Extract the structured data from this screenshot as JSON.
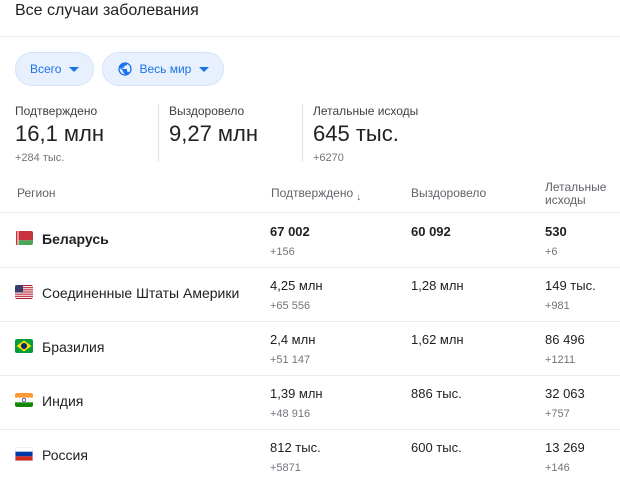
{
  "header": {
    "title": "Все случаи заболевания"
  },
  "filters": {
    "scope": {
      "label": "Всего",
      "icon": "caret-down-icon"
    },
    "region": {
      "label": "Весь мир",
      "icon": "globe-icon"
    }
  },
  "summary": [
    {
      "label": "Подтверждено",
      "value": "16,1 млн",
      "delta": "+284 тыс."
    },
    {
      "label": "Выздоровело",
      "value": "9,27 млн",
      "delta": ""
    },
    {
      "label": "Летальные исходы",
      "value": "645 тыс.",
      "delta": "+6270"
    }
  ],
  "table": {
    "headers": {
      "region": "Регион",
      "confirmed": "Подтверждено",
      "sort_icon": "↓",
      "recovered": "Выздоровело",
      "deaths_1": "Летальные",
      "deaths_2": "исходы"
    },
    "rows": [
      {
        "region": "Беларусь",
        "flag": "by",
        "confirmed": "67 002",
        "confirmed_delta": "+156",
        "recovered": "60 092",
        "deaths": "530",
        "deaths_delta": "+6",
        "selected": true
      },
      {
        "region": "Соединенные Штаты Америки",
        "flag": "us",
        "confirmed": "4,25 млн",
        "confirmed_delta": "+65 556",
        "recovered": "1,28 млн",
        "deaths": "149 тыс.",
        "deaths_delta": "+981"
      },
      {
        "region": "Бразилия",
        "flag": "br",
        "confirmed": "2,4 млн",
        "confirmed_delta": "+51 147",
        "recovered": "1,62 млн",
        "deaths": "86 496",
        "deaths_delta": "+1211"
      },
      {
        "region": "Индия",
        "flag": "in",
        "confirmed": "1,39 млн",
        "confirmed_delta": "+48 916",
        "recovered": "886 тыс.",
        "deaths": "32 063",
        "deaths_delta": "+757"
      },
      {
        "region": "Россия",
        "flag": "ru",
        "confirmed": "812 тыс.",
        "confirmed_delta": "+5871",
        "recovered": "600 тыс.",
        "deaths": "13 269",
        "deaths_delta": "+146"
      }
    ]
  }
}
